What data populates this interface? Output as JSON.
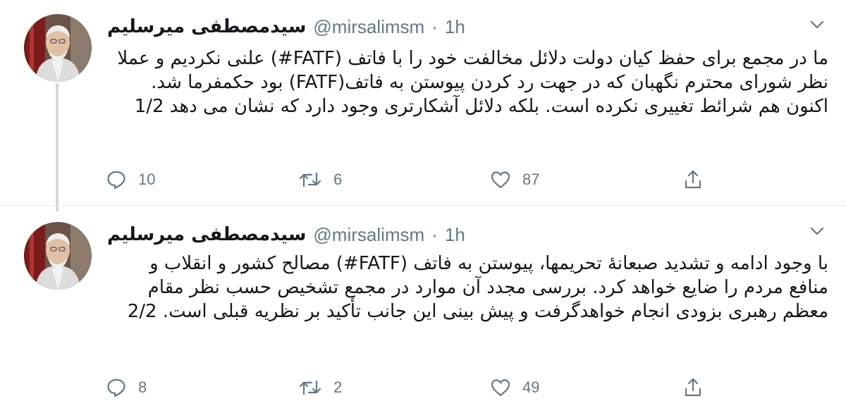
{
  "tweets": [
    {
      "display_name": "سیدمصطفی میرسلیم",
      "handle": "@mirsalimsm",
      "separator": "·",
      "time": "1h",
      "text": "ما در مجمع برای حفظ کیان دولت دلائل مخالفت خود را با فاتف (FATF#) علنی نکردیم و عملا نظر شورای محترم نگهبان که در جهت رد کردن پیوستن به فاتف(FATF) بود حکمفرما شد. اکنون هم شرائط تغییری نکرده است. بلکه دلائل آشکارتری وجود دارد که نشان می دهد 1/2",
      "replies": "10",
      "retweets": "6",
      "likes": "87",
      "icons": {
        "avatar": "profile-photo",
        "menu": "chevron-down-icon",
        "reply": "reply-icon",
        "retweet": "retweet-icon",
        "like": "heart-icon",
        "share": "share-icon"
      }
    },
    {
      "display_name": "سیدمصطفی میرسلیم",
      "handle": "@mirsalimsm",
      "separator": "·",
      "time": "1h",
      "text": "با وجود ادامه و تشدید صبعانۀ تحریمها، پیوستن به فاتف (FATF#) مصالح کشور و انقلاب و منافع مردم را ضایع خواهد کرد. بررسی مجدد آن موارد در مجمع تشخیص حسب نظر مقام معظم رهبری بزودی انجام خواهدگرفت و پیش بینی این جانب تأکید بر نظریه قبلی است. 2/2",
      "replies": "8",
      "retweets": "2",
      "likes": "49",
      "icons": {
        "avatar": "profile-photo",
        "menu": "chevron-down-icon",
        "reply": "reply-icon",
        "retweet": "retweet-icon",
        "like": "heart-icon",
        "share": "share-icon"
      }
    }
  ],
  "colors": {
    "text": "#14171a",
    "secondary": "#657786",
    "divider": "#e6ecf0",
    "thread_line": "#cfd9de"
  }
}
